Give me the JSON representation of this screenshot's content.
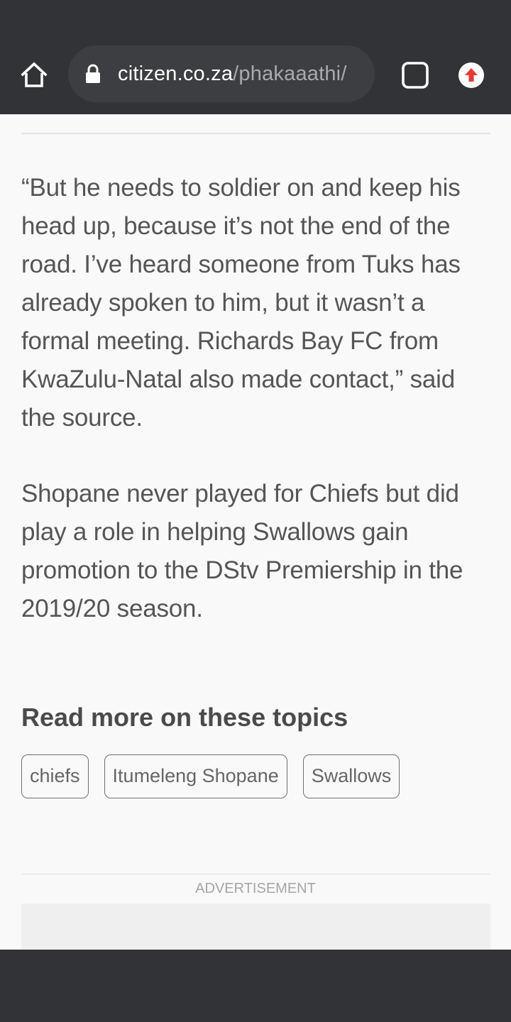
{
  "browser": {
    "url_domain": "citizen.co.za",
    "url_path": "/phakaaathi/",
    "icons": {
      "home": "home-icon",
      "lock": "lock-icon",
      "tabs": "tab-switcher-icon",
      "update": "update-available-icon"
    },
    "colors": {
      "toolbar": "#323336",
      "update_badge": "#e53935"
    }
  },
  "article": {
    "paragraph_1": "“But he needs to soldier on and keep his head up, because it’s not the end of the road. I’ve heard someone from Tuks has already spoken to him, but it wasn’t a formal meeting. Richards Bay FC from KwaZulu-Natal also made contact,” said the source.",
    "paragraph_2": "Shopane never played for Chiefs but did play a role in helping Swallows gain promotion to the DStv Premiership in the 2019/20 season."
  },
  "topics": {
    "heading": "Read more on these topics",
    "tags": [
      "chiefs",
      "Itumeleng Shopane",
      "Swallows"
    ]
  },
  "advertisement": {
    "label": "ADVERTISEMENT"
  }
}
